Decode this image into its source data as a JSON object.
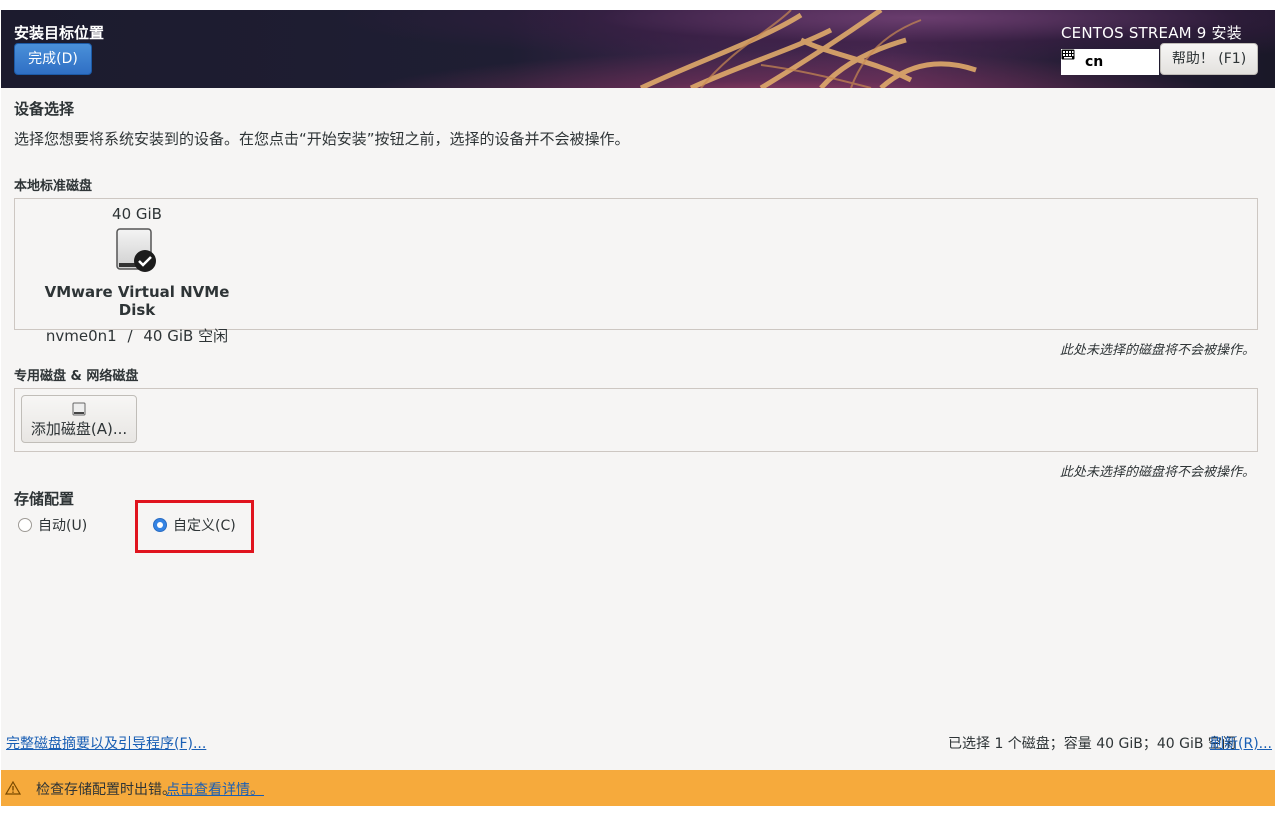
{
  "header": {
    "title": "安装目标位置",
    "done_button": "完成(D)",
    "product": "CENTOS STREAM 9 安装",
    "keyboard_layout": "cn",
    "help_button": "帮助！ (F1)"
  },
  "device_selection": {
    "heading": "设备选择",
    "description": "选择您想要将系统安装到的设备。在您点击“开始安装”按钮之前，选择的设备并不会被操作。"
  },
  "local_disks": {
    "heading": "本地标准磁盘",
    "disks": [
      {
        "size": "40 GiB",
        "name": "VMware Virtual NVMe Disk",
        "device": "nvme0n1",
        "separator": "/",
        "free": "40 GiB 空闲",
        "selected": true
      }
    ],
    "note": "此处未选择的磁盘将不会被操作。"
  },
  "special_disks": {
    "heading": "专用磁盘 & 网络磁盘",
    "add_button": "添加磁盘(A)...",
    "note": "此处未选择的磁盘将不会被操作。"
  },
  "storage_config": {
    "heading": "存储配置",
    "options": [
      {
        "label": "自动(U)",
        "selected": false
      },
      {
        "label": "自定义(C)",
        "selected": true
      }
    ]
  },
  "footer": {
    "summary_link": "完整磁盘摘要以及引导程序(F)...",
    "summary_text": "已选择 1 个磁盘；容量 40 GiB；40 GiB 空闲",
    "refresh_link": "刷新(R)..."
  },
  "warning": {
    "text": "检查存储配置时出错。",
    "link": "点击查看详情。"
  },
  "colors": {
    "accent": "#3584e4",
    "warning_bar": "#f6aa3c",
    "highlight": "#e0141e"
  }
}
